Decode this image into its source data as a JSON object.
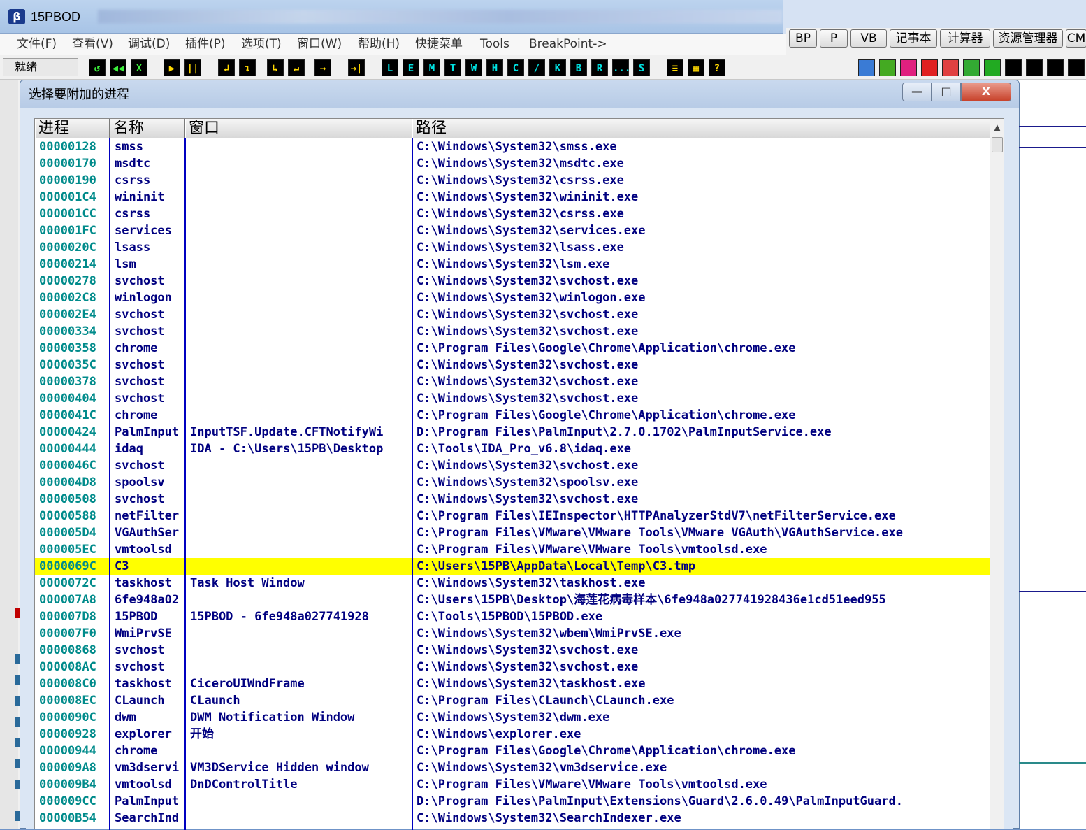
{
  "app": {
    "title": "15PBOD"
  },
  "menu": [
    "文件(F)",
    "查看(V)",
    "调试(D)",
    "插件(P)",
    "选项(T)",
    "窗口(W)",
    "帮助(H)",
    "快捷菜单",
    "Tools",
    "BreakPoint->"
  ],
  "quick_buttons": [
    "BP",
    "P",
    "VB",
    "记事本",
    "计算器",
    "资源管理器",
    "CM"
  ],
  "status": "就绪",
  "toolbar_glyphs": [
    "↺",
    "◀◀",
    "X",
    "▶",
    "||",
    "↲",
    "↴",
    "↳",
    "↵",
    "→",
    "→|",
    "L",
    "E",
    "M",
    "T",
    "W",
    "H",
    "C",
    "/",
    "K",
    "B",
    "R",
    "...",
    "S",
    "≡",
    "▦",
    "?"
  ],
  "dialog": {
    "title": "选择要附加的进程",
    "min_glyph": "—",
    "max_glyph": "□",
    "close_glyph": "X"
  },
  "columns": [
    "进程",
    "名称",
    "窗口",
    "路径"
  ],
  "rows": [
    [
      "00000128",
      "smss",
      "",
      "C:\\Windows\\System32\\smss.exe"
    ],
    [
      "00000170",
      "msdtc",
      "",
      "C:\\Windows\\System32\\msdtc.exe"
    ],
    [
      "00000190",
      "csrss",
      "",
      "C:\\Windows\\System32\\csrss.exe"
    ],
    [
      "000001C4",
      "wininit",
      "",
      "C:\\Windows\\System32\\wininit.exe"
    ],
    [
      "000001CC",
      "csrss",
      "",
      "C:\\Windows\\System32\\csrss.exe"
    ],
    [
      "000001FC",
      "services",
      "",
      "C:\\Windows\\System32\\services.exe"
    ],
    [
      "0000020C",
      "lsass",
      "",
      "C:\\Windows\\System32\\lsass.exe"
    ],
    [
      "00000214",
      "lsm",
      "",
      "C:\\Windows\\System32\\lsm.exe"
    ],
    [
      "00000278",
      "svchost",
      "",
      "C:\\Windows\\System32\\svchost.exe"
    ],
    [
      "000002C8",
      "winlogon",
      "",
      "C:\\Windows\\System32\\winlogon.exe"
    ],
    [
      "000002E4",
      "svchost",
      "",
      "C:\\Windows\\System32\\svchost.exe"
    ],
    [
      "00000334",
      "svchost",
      "",
      "C:\\Windows\\System32\\svchost.exe"
    ],
    [
      "00000358",
      "chrome",
      "",
      "C:\\Program Files\\Google\\Chrome\\Application\\chrome.exe"
    ],
    [
      "0000035C",
      "svchost",
      "",
      "C:\\Windows\\System32\\svchost.exe"
    ],
    [
      "00000378",
      "svchost",
      "",
      "C:\\Windows\\System32\\svchost.exe"
    ],
    [
      "00000404",
      "svchost",
      "",
      "C:\\Windows\\System32\\svchost.exe"
    ],
    [
      "0000041C",
      "chrome",
      "",
      "C:\\Program Files\\Google\\Chrome\\Application\\chrome.exe"
    ],
    [
      "00000424",
      "PalmInput",
      "InputTSF.Update.CFTNotifyWi",
      "D:\\Program Files\\PalmInput\\2.7.0.1702\\PalmInputService.exe"
    ],
    [
      "00000444",
      "idaq",
      "IDA - C:\\Users\\15PB\\Desktop",
      "C:\\Tools\\IDA_Pro_v6.8\\idaq.exe"
    ],
    [
      "0000046C",
      "svchost",
      "",
      "C:\\Windows\\System32\\svchost.exe"
    ],
    [
      "000004D8",
      "spoolsv",
      "",
      "C:\\Windows\\System32\\spoolsv.exe"
    ],
    [
      "00000508",
      "svchost",
      "",
      "C:\\Windows\\System32\\svchost.exe"
    ],
    [
      "00000588",
      "netFilter",
      "",
      "C:\\Program Files\\IEInspector\\HTTPAnalyzerStdV7\\netFilterService.exe"
    ],
    [
      "000005D4",
      "VGAuthSer",
      "",
      "C:\\Program Files\\VMware\\VMware Tools\\VMware VGAuth\\VGAuthService.exe"
    ],
    [
      "000005EC",
      "vmtoolsd",
      "",
      "C:\\Program Files\\VMware\\VMware Tools\\vmtoolsd.exe"
    ],
    [
      "0000069C",
      "C3",
      "",
      "C:\\Users\\15PB\\AppData\\Local\\Temp\\C3.tmp"
    ],
    [
      "0000072C",
      "taskhost",
      "Task Host Window",
      "C:\\Windows\\System32\\taskhost.exe"
    ],
    [
      "000007A8",
      "6fe948a02",
      "",
      "C:\\Users\\15PB\\Desktop\\海莲花病毒样本\\6fe948a027741928436e1cd51eed955"
    ],
    [
      "000007D8",
      "15PBOD",
      "15PBOD - 6fe948a027741928",
      "C:\\Tools\\15PBOD\\15PBOD.exe"
    ],
    [
      "000007F0",
      "WmiPrvSE",
      "",
      "C:\\Windows\\System32\\wbem\\WmiPrvSE.exe"
    ],
    [
      "00000868",
      "svchost",
      "",
      "C:\\Windows\\System32\\svchost.exe"
    ],
    [
      "000008AC",
      "svchost",
      "",
      "C:\\Windows\\System32\\svchost.exe"
    ],
    [
      "000008C0",
      "taskhost",
      "CiceroUIWndFrame",
      "C:\\Windows\\System32\\taskhost.exe"
    ],
    [
      "000008EC",
      "CLaunch",
      "CLaunch",
      "C:\\Program Files\\CLaunch\\CLaunch.exe"
    ],
    [
      "0000090C",
      "dwm",
      "DWM Notification Window",
      "C:\\Windows\\System32\\dwm.exe"
    ],
    [
      "00000928",
      "explorer",
      "开始",
      "C:\\Windows\\explorer.exe"
    ],
    [
      "00000944",
      "chrome",
      "",
      "C:\\Program Files\\Google\\Chrome\\Application\\chrome.exe"
    ],
    [
      "000009A8",
      "vm3dservi",
      "VM3DService Hidden window",
      "C:\\Windows\\System32\\vm3dservice.exe"
    ],
    [
      "000009B4",
      "vmtoolsd",
      "DnDControlTitle",
      "C:\\Program Files\\VMware\\VMware Tools\\vmtoolsd.exe"
    ],
    [
      "000009CC",
      "PalmInput",
      "",
      "D:\\Program Files\\PalmInput\\Extensions\\Guard\\2.6.0.49\\PalmInputGuard."
    ],
    [
      "00000B54",
      "SearchInd",
      "",
      "C:\\Windows\\System32\\SearchIndexer.exe"
    ]
  ],
  "selected_pid": "0000069C",
  "colors": {
    "pid": "#008b8b",
    "text": "#000080",
    "selected_bg": "#ffff00",
    "grid_line": "#0000c0"
  }
}
